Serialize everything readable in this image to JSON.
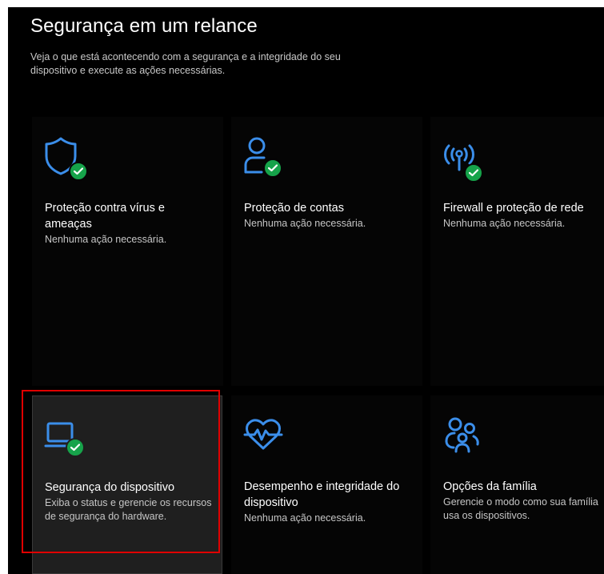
{
  "page": {
    "title": "Segurança em um relance",
    "subtitle": "Veja o que está acontecendo com a segurança e a integridade do seu dispositivo e execute as ações necessárias."
  },
  "tiles": [
    {
      "title": "Proteção contra vírus e ameaças",
      "description": "Nenhuma ação necessária.",
      "icon": "shield-icon",
      "status": "check-badge"
    },
    {
      "title": "Proteção de contas",
      "description": "Nenhuma ação necessária.",
      "icon": "person-icon",
      "status": "check-badge"
    },
    {
      "title": "Firewall e proteção de rede",
      "description": "Nenhuma ação necessária.",
      "icon": "wireless-antenna-icon",
      "status": "check-badge"
    },
    {
      "title": "Segurança do dispositivo",
      "description": "Exiba o status e gerencie os recursos de segurança do hardware.",
      "icon": "laptop-icon",
      "status": "check-badge"
    },
    {
      "title": "Desempenho e integridade do dispositivo",
      "description": "Nenhuma ação necessária.",
      "icon": "heart-pulse-icon",
      "status": "none"
    },
    {
      "title": "Opções da família",
      "description": "Gerencie o modo como sua família usa os dispositivos.",
      "icon": "family-icon",
      "status": "none"
    }
  ],
  "colors": {
    "accent": "#3b8eea",
    "status_ok": "#16a34a",
    "highlight": "#e00000",
    "background": "#000000"
  }
}
